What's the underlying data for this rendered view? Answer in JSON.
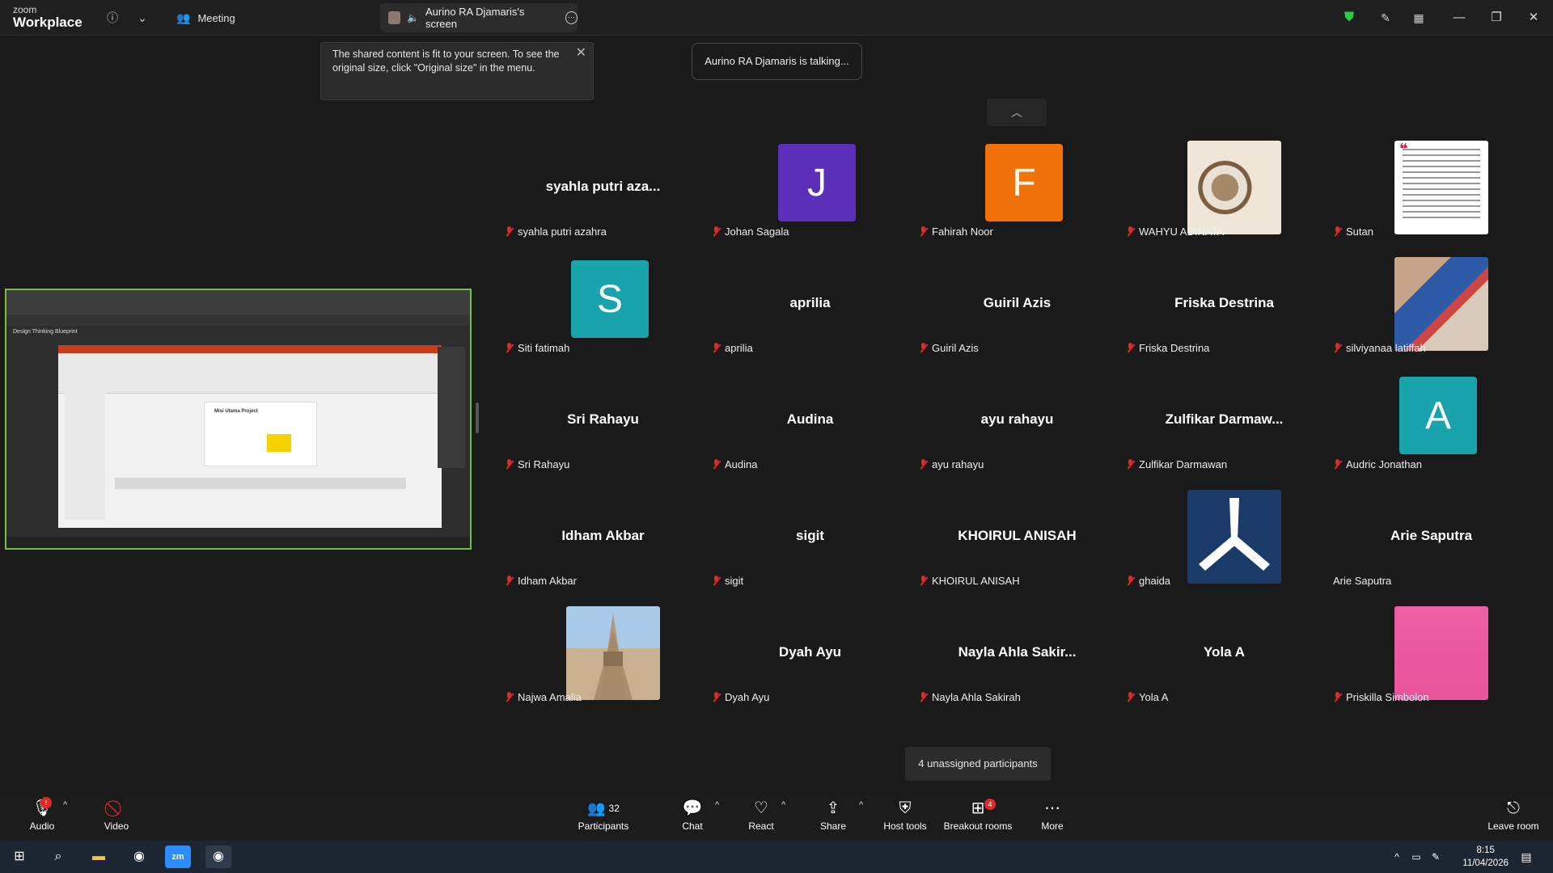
{
  "topbar": {
    "logo_line1": "zoom",
    "logo_line2": "Workplace",
    "meeting_label": "Meeting",
    "screen_tab_label": "Aurino RA Djamaris's screen",
    "shield_color": "#2ecc40"
  },
  "notice": {
    "text": "The shared content is fit to your screen. To see the original size, click \"Original size\" in the menu."
  },
  "talking_indicator": "Aurino RA Djamaris is talking...",
  "shared_screen": {
    "doc_title": "Design Thinking Blueprint",
    "slide_title": "Misi Utama Project"
  },
  "participants": [
    {
      "display": "syahla putri aza...",
      "name": "syahla putri azahra",
      "muted": true,
      "type": "name"
    },
    {
      "display": "J",
      "name": "Johan Sagala",
      "muted": true,
      "type": "letter",
      "color": "#5b2fb8"
    },
    {
      "display": "F",
      "name": "Fahirah Noor",
      "muted": true,
      "type": "letter",
      "color": "#f07208"
    },
    {
      "display": "",
      "name": "WAHYU ADINATA",
      "muted": true,
      "type": "photo",
      "photo": "batik"
    },
    {
      "display": "",
      "name": "Sutan",
      "muted": true,
      "type": "photo",
      "photo": "quote"
    },
    {
      "display": "S",
      "name": "Siti fatimah",
      "muted": true,
      "type": "letter",
      "color": "#18a3ad"
    },
    {
      "display": "aprilia",
      "name": "aprilia",
      "muted": true,
      "type": "name"
    },
    {
      "display": "Guiril Azis",
      "name": "Guiril Azis",
      "muted": true,
      "type": "name"
    },
    {
      "display": "Friska Destrina",
      "name": "Friska Destrina",
      "muted": true,
      "type": "name"
    },
    {
      "display": "",
      "name": "silviyanaa latiffah",
      "muted": true,
      "type": "photo",
      "photo": "cafe"
    },
    {
      "display": "Sri Rahayu",
      "name": "Sri Rahayu",
      "muted": true,
      "type": "name"
    },
    {
      "display": "Audina",
      "name": "Audina",
      "muted": true,
      "type": "name"
    },
    {
      "display": "ayu rahayu",
      "name": "ayu rahayu",
      "muted": true,
      "type": "name"
    },
    {
      "display": "Zulfikar  Darmaw...",
      "name": "Zulfikar Darmawan",
      "muted": true,
      "type": "name"
    },
    {
      "display": "A",
      "name": "Audric Jonathan",
      "muted": true,
      "type": "letter",
      "color": "#18a3ad"
    },
    {
      "display": "Idham Akbar",
      "name": "Idham Akbar",
      "muted": true,
      "type": "name"
    },
    {
      "display": "sigit",
      "name": "sigit",
      "muted": true,
      "type": "name"
    },
    {
      "display": "KHOIRUL ANISAH",
      "name": "KHOIRUL ANISAH",
      "muted": true,
      "type": "name"
    },
    {
      "display": "",
      "name": "ghaida",
      "muted": true,
      "type": "photo",
      "photo": "logo"
    },
    {
      "display": "Arie Saputra",
      "name": "Arie Saputra",
      "muted": false,
      "type": "name"
    },
    {
      "display": "",
      "name": "Najwa Amalia",
      "muted": true,
      "type": "photo",
      "photo": "temple"
    },
    {
      "display": "Dyah Ayu",
      "name": "Dyah Ayu",
      "muted": true,
      "type": "name"
    },
    {
      "display": "Nayla Ahla Sakir...",
      "name": "Nayla Ahla Sakirah",
      "muted": true,
      "type": "name"
    },
    {
      "display": "Yola A",
      "name": "Yola A",
      "muted": true,
      "type": "name"
    },
    {
      "display": "",
      "name": "Priskilla Simbolon",
      "muted": true,
      "type": "photo",
      "photo": "pink"
    }
  ],
  "unassigned": "4 unassigned participants",
  "toolbar": {
    "audio": "Audio",
    "video": "Video",
    "participants": "Participants",
    "participants_count": "32",
    "chat": "Chat",
    "react": "React",
    "share": "Share",
    "host_tools": "Host tools",
    "breakout_rooms": "Breakout rooms",
    "breakout_badge": "4",
    "more": "More",
    "leave": "Leave room",
    "audio_badge": "!"
  },
  "taskbar": {
    "time": "8:15",
    "date": "11/04/2026"
  }
}
